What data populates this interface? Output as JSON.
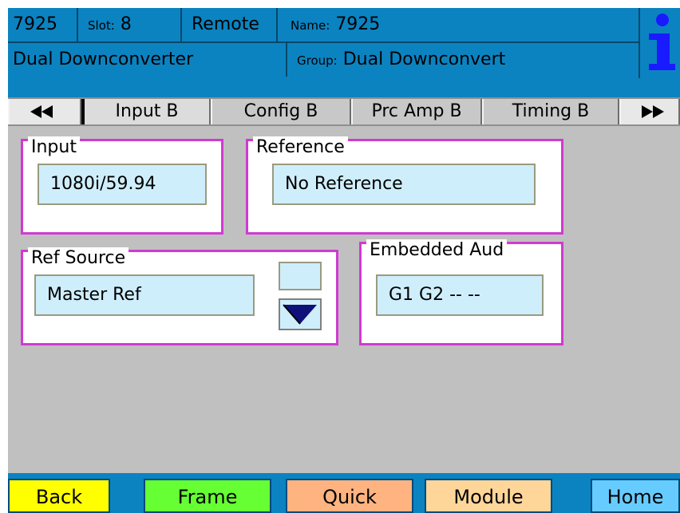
{
  "header": {
    "model": "7925",
    "slot_label": "Slot:",
    "slot_value": "8",
    "mode": "Remote",
    "name_label": "Name:",
    "name_value": "7925",
    "description": "Dual Downconverter",
    "group_label": "Group:",
    "group_value": "Dual Downconvert",
    "info_icon": "info-icon"
  },
  "tabs": {
    "prev_icon": "double-left-arrow",
    "next_icon": "double-right-arrow",
    "items": [
      {
        "label": "Input B"
      },
      {
        "label": "Config B"
      },
      {
        "label": "Prc Amp B"
      },
      {
        "label": "Timing B"
      }
    ],
    "active": "Input B"
  },
  "panels": {
    "input": {
      "label": "Input",
      "value": "1080i/59.94"
    },
    "reference": {
      "label": "Reference",
      "value": "No Reference"
    },
    "ref_source": {
      "label": "Ref Source",
      "value": "Master Ref",
      "dropdown_icon": "triangle-down-icon"
    },
    "embedded_aud": {
      "label": "Embedded Aud",
      "value": "G1 G2 -- --"
    }
  },
  "footer": {
    "back": "Back",
    "frame": "Frame",
    "quick": "Quick",
    "module": "Module",
    "home": "Home"
  },
  "colors": {
    "header_blue": "#0b83c1",
    "panel_border": "#d13ad1",
    "field_bg": "#cfeefc",
    "back_btn": "#ffff00",
    "frame_btn": "#66ff33",
    "quick_btn": "#ffb380",
    "module_btn": "#ffd699",
    "home_btn": "#66ccff"
  }
}
